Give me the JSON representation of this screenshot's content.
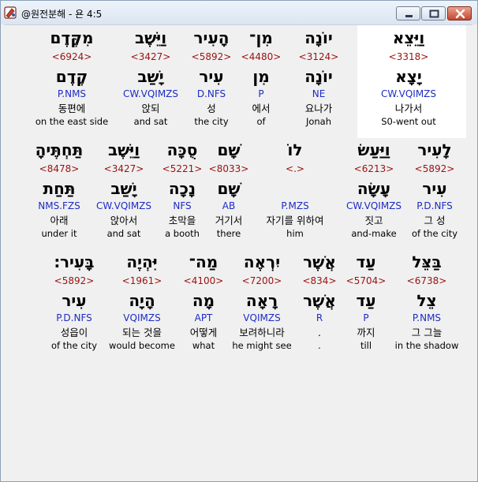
{
  "window": {
    "title": "@원전분해 - 욘 4:5"
  },
  "rows": [
    {
      "words": [
        {
          "heb": "מִקֶּדֶם",
          "strong": "<6924>",
          "lemma": "קֶדֶם",
          "parse": "P.NMS",
          "kor": "동편에",
          "eng": "on the east side"
        },
        {
          "heb": "וַיֵּשֶׁב",
          "strong": "<3427>",
          "lemma": "יָשַׁב",
          "parse": "CW.VQIMZS",
          "kor": "앉되",
          "eng": "and sat"
        },
        {
          "heb": "הָעִיר",
          "strong": "<5892>",
          "lemma": "עִיר",
          "parse": "D.NFS",
          "kor": "성",
          "eng": "the city"
        },
        {
          "heb": "מִן־",
          "strong": "<4480>",
          "lemma": "מִן",
          "parse": "P",
          "kor": "에서",
          "eng": "of"
        },
        {
          "heb": "יוֹנָה",
          "strong": "<3124>",
          "lemma": "יוֹנָה",
          "parse": "NE",
          "kor": "요나가",
          "eng": "Jonah"
        },
        {
          "heb": "וַיֵּצֵא",
          "strong": "<3318>",
          "lemma": "יָצָא",
          "parse": "CW.VQIMZS",
          "kor": "나가서",
          "eng": "S0-went out"
        }
      ]
    },
    {
      "words": [
        {
          "heb": "תַּחְתֶּיהָ",
          "strong": "<8478>",
          "lemma": "תַּחַת",
          "parse": "NMS.FZS",
          "kor": "아래",
          "eng": "under it"
        },
        {
          "heb": "וַיֵּשֶׁב",
          "strong": "<3427>",
          "lemma": "יָשַׁב",
          "parse": "CW.VQIMZS",
          "kor": "앉아서",
          "eng": "and sat"
        },
        {
          "heb": "סֻכָּה",
          "strong": "<5221>",
          "lemma": "נָכָה",
          "parse": "NFS",
          "kor": "초막을",
          "eng": "a booth"
        },
        {
          "heb": "שָׁם",
          "strong": "<8033>",
          "lemma": "שָׁם",
          "parse": "AB",
          "kor": "거기서",
          "eng": "there"
        },
        {
          "heb": "לוֹ",
          "strong": "<.>",
          "lemma": "",
          "parse": "P.MZS",
          "kor": "자기를 위하여",
          "eng": "him"
        },
        {
          "heb": "וַיַּעַשׂ",
          "strong": "<6213>",
          "lemma": "עָשָׂה",
          "parse": "CW.VQIMZS",
          "kor": "짓고",
          "eng": "and-make"
        },
        {
          "heb": "לָעִיר",
          "strong": "<5892>",
          "lemma": "עִיר",
          "parse": "P.D.NFS",
          "kor": "그 성",
          "eng": "of the city"
        }
      ]
    },
    {
      "words": [
        {
          "heb": "בָּעִיר׃",
          "strong": "<5892>",
          "lemma": "עִיר",
          "parse": "P.D.NFS",
          "kor": "성읍이",
          "eng": "of the city"
        },
        {
          "heb": "יִּהְיֶה",
          "strong": "<1961>",
          "lemma": "הָיָה",
          "parse": "VQIMZS",
          "kor": "되는 것을",
          "eng": "would become"
        },
        {
          "heb": "מַה־",
          "strong": "<4100>",
          "lemma": "מָה",
          "parse": "APT",
          "kor": "어떻게",
          "eng": "what"
        },
        {
          "heb": "יִרְאֶה",
          "strong": "<7200>",
          "lemma": "רָאָה",
          "parse": "VQIMZS",
          "kor": "보려하니라",
          "eng": "he might see"
        },
        {
          "heb": "אֲשֶׁר",
          "strong": "<834>",
          "lemma": "אֲשֶׁר",
          "parse": "R",
          "kor": ".",
          "eng": "."
        },
        {
          "heb": "עַד",
          "strong": "<5704>",
          "lemma": "עַד",
          "parse": "P",
          "kor": "까지",
          "eng": "till"
        },
        {
          "heb": "בַּצֵּל",
          "strong": "<6738>",
          "lemma": "צֵל",
          "parse": "P.NMS",
          "kor": "그 그늘",
          "eng": "in the shadow"
        }
      ]
    }
  ]
}
